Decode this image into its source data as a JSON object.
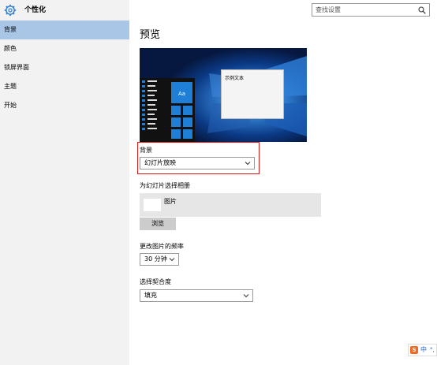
{
  "app": {
    "title": "个性化",
    "icon": "gear-icon"
  },
  "search": {
    "placeholder": "查找设置",
    "icon": "search-icon"
  },
  "sidebar": {
    "items": [
      {
        "label": "背景",
        "active": true
      },
      {
        "label": "颜色",
        "active": false
      },
      {
        "label": "锁屏界面",
        "active": false
      },
      {
        "label": "主题",
        "active": false
      },
      {
        "label": "开始",
        "active": false
      }
    ]
  },
  "main": {
    "preview_title": "预览",
    "preview_sample_text": "示例文本",
    "preview_tile_text": "Aa",
    "background": {
      "label": "背景",
      "value": "幻灯片放映"
    },
    "album": {
      "label": "为幻灯片选择相册",
      "name": "图片",
      "browse_label": "浏览"
    },
    "frequency": {
      "label": "更改图片的频率",
      "value": "30 分钟"
    },
    "fit": {
      "label": "选择契合度",
      "value": "填充"
    }
  },
  "ime": {
    "logo": "S",
    "lang": "中",
    "extra": "°,"
  },
  "colors": {
    "accent": "#0078d7",
    "sidebar_active": "#a9c6e7",
    "highlight_box": "#e01b1b"
  }
}
